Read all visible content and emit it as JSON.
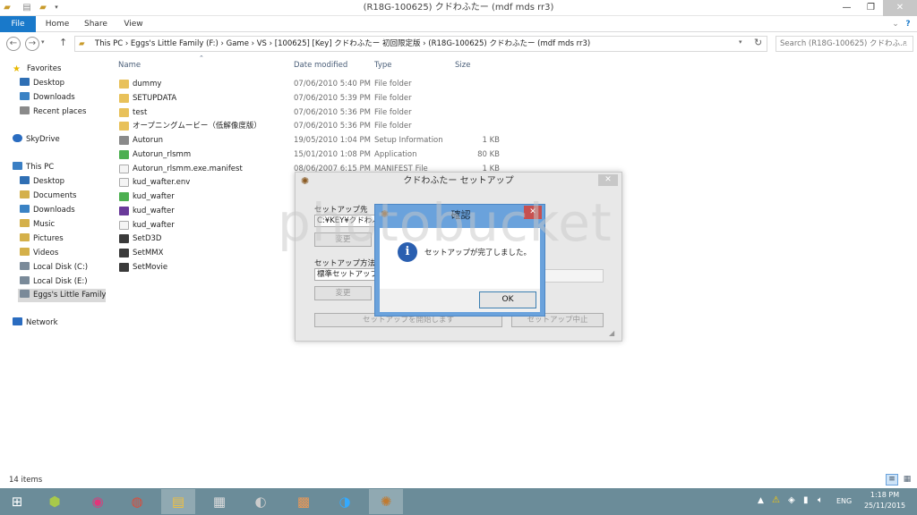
{
  "window": {
    "title": "(R18G-100625) クドわふたー (mdf mds rr3)",
    "minimize": "—",
    "maximize": "❐",
    "close": "✕"
  },
  "ribbon": {
    "tabs": [
      "File",
      "Home",
      "Share",
      "View"
    ],
    "help": "?"
  },
  "address": {
    "path": "This PC  ›  Eggs's Little Family (F:)  ›  Game  ›  VS  ›  [100625] [Key] クドわふたー 初回限定版  ›  (R18G-100625) クドわふたー (mdf mds rr3)",
    "search_placeholder": "Search (R18G-100625) クドわふ..."
  },
  "nav": {
    "favorites": "Favorites",
    "fav_items": [
      "Desktop",
      "Downloads",
      "Recent places"
    ],
    "skydrive": "SkyDrive",
    "thispc": "This PC",
    "pc_items": [
      "Desktop",
      "Documents",
      "Downloads",
      "Music",
      "Pictures",
      "Videos",
      "Local Disk (C:)",
      "Local Disk (E:)",
      "Eggs's Little Family ("
    ],
    "network": "Network"
  },
  "columns": {
    "name": "Name",
    "date": "Date modified",
    "type": "Type",
    "size": "Size"
  },
  "files": [
    {
      "name": "dummy",
      "date": "07/06/2010 5:40 PM",
      "type": "File folder",
      "size": "",
      "icon": "folder"
    },
    {
      "name": "SETUPDATA",
      "date": "07/06/2010 5:39 PM",
      "type": "File folder",
      "size": "",
      "icon": "folder"
    },
    {
      "name": "test",
      "date": "07/06/2010 5:36 PM",
      "type": "File folder",
      "size": "",
      "icon": "folder"
    },
    {
      "name": "オープニングムービー（低解像度版）",
      "date": "07/06/2010 5:36 PM",
      "type": "File folder",
      "size": "",
      "icon": "folder"
    },
    {
      "name": "Autorun",
      "date": "19/05/2010 1:04 PM",
      "type": "Setup Information",
      "size": "1 KB",
      "icon": "gear"
    },
    {
      "name": "Autorun_rlsmm",
      "date": "15/01/2010 1:08 PM",
      "type": "Application",
      "size": "80 KB",
      "icon": "app"
    },
    {
      "name": "Autorun_rlsmm.exe.manifest",
      "date": "08/06/2007 6:15 PM",
      "type": "MANIFEST File",
      "size": "1 KB",
      "icon": "file"
    },
    {
      "name": "kud_wafter.env",
      "date": "",
      "type": "",
      "size": "",
      "icon": "file"
    },
    {
      "name": "kud_wafter",
      "date": "",
      "type": "",
      "size": "",
      "icon": "app"
    },
    {
      "name": "kud_wafter",
      "date": "",
      "type": "",
      "size": "",
      "icon": "img"
    },
    {
      "name": "kud_wafter",
      "date": "",
      "type": "",
      "size": "",
      "icon": "file"
    },
    {
      "name": "SetD3D",
      "date": "",
      "type": "",
      "size": "",
      "icon": "tool"
    },
    {
      "name": "SetMMX",
      "date": "",
      "type": "",
      "size": "",
      "icon": "tool"
    },
    {
      "name": "SetMovie",
      "date": "",
      "type": "",
      "size": "",
      "icon": "tool"
    }
  ],
  "status": {
    "count": "14 items"
  },
  "setup": {
    "title": "クドわふたー セットアップ",
    "dest_label": "セットアップ先",
    "dest_value": "C:¥KEY¥クドわふ",
    "change1": "変更",
    "method_label": "セットアップ方法",
    "method_value": "標準セットアップ",
    "change2": "変更",
    "start_button": "セットアップを開始します",
    "cancel_button": "セットアップ中止"
  },
  "dialog": {
    "title": "確認",
    "message": "セットアップが完了しました。",
    "ok": "OK",
    "icon": "info-icon"
  },
  "taskbar": {
    "lang": "ENG",
    "time": "1:18 PM",
    "date": "25/11/2015"
  },
  "colors": {
    "accent": "#1979ca",
    "taskbar": "#6b8c99",
    "dialog_frame": "#6aa2dc",
    "close_red": "#c75050"
  }
}
